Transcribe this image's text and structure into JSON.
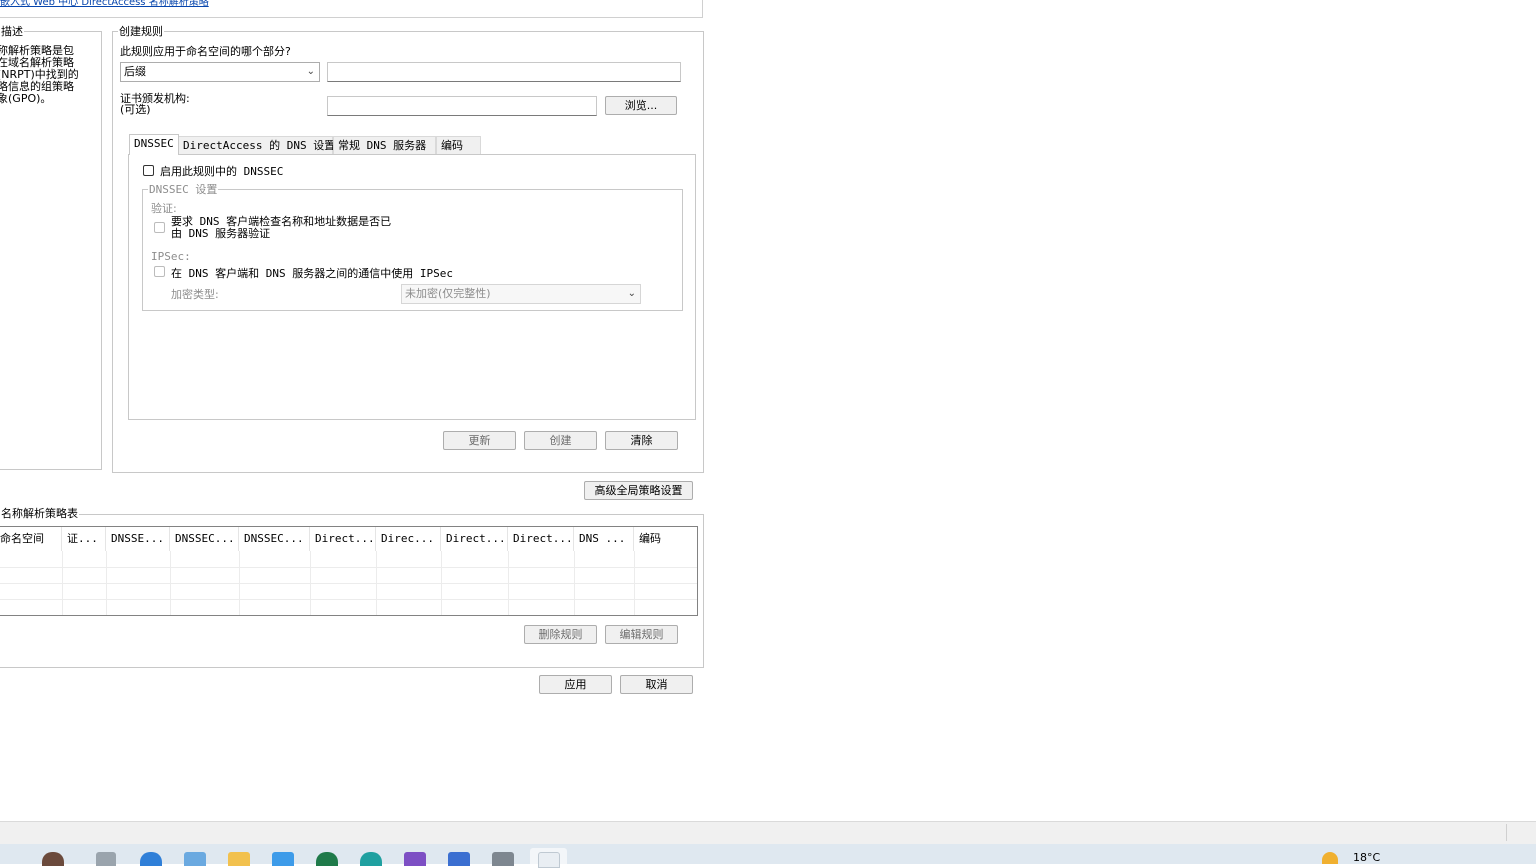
{
  "top_link": "嵌入式 Web 中心 DirectAccess 名称解析策略",
  "left_panel": {
    "title": "描述",
    "description_lines": [
      "名称解析策略是包",
      "含在域名解析策略",
      "表(NRPT)中找到的",
      "策略信息的组策略",
      "对象(GPO)。"
    ]
  },
  "create_rule": {
    "title": "创建规则",
    "namespace_question": "此规则应用于命名空间的哪个部分?",
    "namespace_select_value": "后缀",
    "namespace_input_value": "",
    "cert_label_line1": "证书颁发机构:",
    "cert_label_line2": "(可选)",
    "cert_input_value": "",
    "browse_button": "浏览...",
    "tabs": [
      "DNSSEC",
      "DirectAccess 的 DNS 设置",
      "常规 DNS 服务器",
      "编码"
    ],
    "active_tab": "DNSSEC",
    "enable_dnssec_label": "启用此规则中的 DNSSEC",
    "dnssec_settings": {
      "title": "DNSSEC 设置",
      "validation_label": "验证:",
      "require_validation_line1": "要求 DNS 客户端检查名称和地址数据是否已",
      "require_validation_line2": "由 DNS 服务器验证",
      "ipsec_label": "IPSec:",
      "use_ipsec_label": "在 DNS 客户端和 DNS 服务器之间的通信中使用 IPSec",
      "encryption_type_label": "加密类型:",
      "encryption_type_value": "未加密(仅完整性)"
    },
    "update_button": "更新",
    "create_button": "创建",
    "clear_button": "清除"
  },
  "advanced_button": "高级全局策略设置",
  "policy_table": {
    "title": "名称解析策略表",
    "columns": [
      "命名空间",
      "证...",
      "DNSSE...",
      "DNSSEC...",
      "DNSSEC...",
      "Direct...",
      "Direc...",
      "Direct...",
      "Direct...",
      "DNS ...",
      "编码"
    ],
    "rows": []
  },
  "delete_rule_button": "删除规则",
  "edit_rule_button": "编辑规则",
  "apply_button": "应用",
  "cancel_button": "取消",
  "taskbar": {
    "weather_temp": "18°C"
  }
}
